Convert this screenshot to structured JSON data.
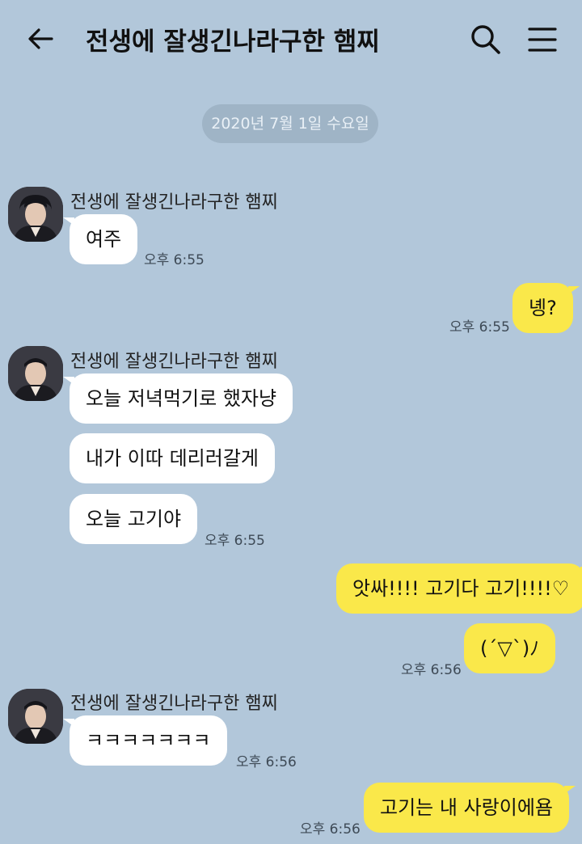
{
  "header": {
    "title": "전생에 잘생긴나라구한 햄찌",
    "back_icon": "arrow-left-icon",
    "search_icon": "search-icon",
    "menu_icon": "hamburger-menu-icon"
  },
  "date_divider": "2020년 7월 1일 수요일",
  "colors": {
    "background": "#b2c7da",
    "incoming_bubble": "#ffffff",
    "outgoing_bubble": "#fae84a",
    "date_pill": "#9fb4c6"
  },
  "messages": [
    {
      "sender": "전생에 잘생긴나라구한 햄찌",
      "text": "여주",
      "time": "오후 6:55"
    },
    {
      "text": "녱?",
      "time": "오후 6:55"
    },
    {
      "sender": "전생에 잘생긴나라구한 햄찌",
      "text": "오늘 저녁먹기로 했자냥"
    },
    {
      "text": "내가 이따 데리러갈게"
    },
    {
      "text": "오늘 고기야",
      "time": "오후 6:55"
    },
    {
      "text": "앗싸!!!! 고기다 고기!!!!♡"
    },
    {
      "text": "(´▽`)ﾉ",
      "time": "오후 6:56"
    },
    {
      "sender": "전생에 잘생긴나라구한 햄찌",
      "text": "ㅋㅋㅋㅋㅋㅋㅋ",
      "time": "오후 6:56"
    },
    {
      "text": "고기는 내 사랑이에욤",
      "time": "오후 6:56"
    }
  ]
}
